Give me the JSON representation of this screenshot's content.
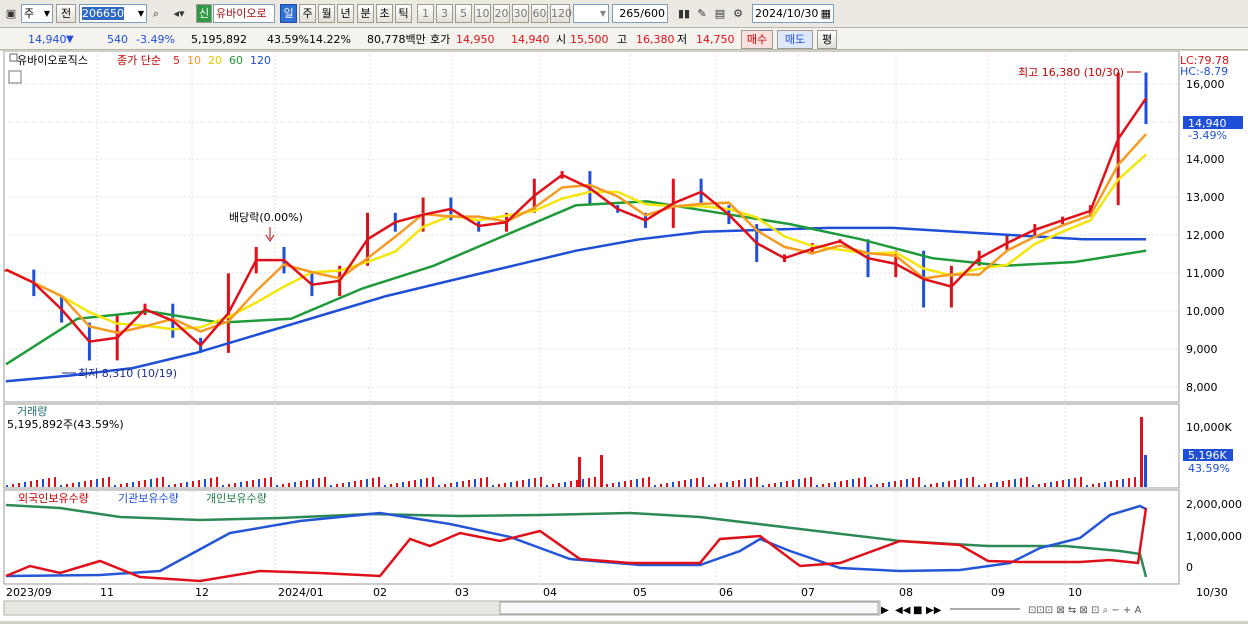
{
  "toolbar": {
    "period_select": "주",
    "prev_label": "전",
    "code": "206650",
    "name_badge": "신",
    "name": "유바이오로",
    "period_buttons": [
      "일",
      "주",
      "월",
      "년",
      "분",
      "초",
      "틱"
    ],
    "active_period": "일",
    "minute_buttons": [
      "1",
      "3",
      "5",
      "10",
      "20",
      "30",
      "60",
      "120"
    ],
    "count": "265",
    "count_total": "/600",
    "date": "2024/10/30",
    "colors": {
      "up": "#e0101a",
      "down": "#1f4fd6",
      "accent": "#2f6fd6"
    }
  },
  "quote": {
    "price": "14,940",
    "down_arrow": "▼",
    "change": "540",
    "change_pct": "-3.49%",
    "volume": "5,195,892",
    "vol_ratio": "43.59%",
    "turnover": "14.22%",
    "amount": "80,778백만",
    "bid_label": "호가",
    "bid1": "14,950",
    "bid2": "14,940",
    "open_label": "시",
    "open": "15,500",
    "high_label": "고",
    "high": "16,380",
    "low_label": "저",
    "low": "14,750",
    "buy_label": "매수",
    "sell_label": "매도",
    "eval_label": "평"
  },
  "chart": {
    "name_tag": "유바이오로직스",
    "ma_label": "종가 단순",
    "ma_periods": [
      "5",
      "10",
      "20",
      "60",
      "120"
    ],
    "ma_colors": [
      "#e0101a",
      "#f59a23",
      "#f5e60a",
      "#1f9a3a",
      "#1f4fd6"
    ],
    "lc": "LC:79.78",
    "hc": "HC:-8.79",
    "high_note": "최고 16,380 (10/30)",
    "low_note": "최저 8,310 (10/19)",
    "dividend_note": "배당락(0.00%)",
    "price_tag": "14,940",
    "price_tag_pct": "-3.49%",
    "volume_title": "거래량",
    "volume_value": "5,195,892주(43.59%)",
    "volume_tag": "5,196K",
    "volume_tag_pct": "43.59%",
    "holdings": [
      "외국인보유수량",
      "기관보유수량",
      "개인보유수량"
    ],
    "x_labels": [
      "2023/09",
      "11",
      "12",
      "2024/01",
      "02",
      "03",
      "04",
      "05",
      "06",
      "07",
      "08",
      "09",
      "10",
      "10/30"
    ]
  },
  "chart_data": {
    "type": "line",
    "y_ticks": [
      "16,000",
      "15,000",
      "14,000",
      "13,000",
      "12,000",
      "11,000",
      "10,000",
      "9,000",
      "8,000"
    ],
    "price_path": [
      11100,
      10400,
      9700,
      8700,
      9900,
      10200,
      9300,
      8900,
      11000,
      11700,
      11000,
      10400,
      11200,
      12600,
      12100,
      13000,
      12400,
      12100,
      12600,
      13500,
      13700,
      12800,
      12600,
      12200,
      13500,
      12800,
      12300,
      11300,
      11500,
      11800,
      11900,
      10900,
      11600,
      10100,
      11200,
      11600,
      12000,
      12300,
      12500,
      12800,
      16300,
      14940
    ],
    "ma120_path": [
      8150,
      8300,
      8500,
      8900,
      9400,
      9900,
      10400,
      10800,
      11200,
      11600,
      11900,
      12100,
      12150,
      12200,
      12200,
      12100,
      12000,
      11900,
      11900
    ],
    "ma60_path": [
      8600,
      9800,
      10000,
      9700,
      9800,
      10600,
      11200,
      12000,
      12800,
      12900,
      12600,
      12300,
      11900,
      11400,
      11200,
      11300,
      11600
    ],
    "volume_ticks": [
      "10,000K"
    ],
    "holdings_ticks": [
      "2,000,000",
      "1,000,000",
      "0"
    ]
  }
}
